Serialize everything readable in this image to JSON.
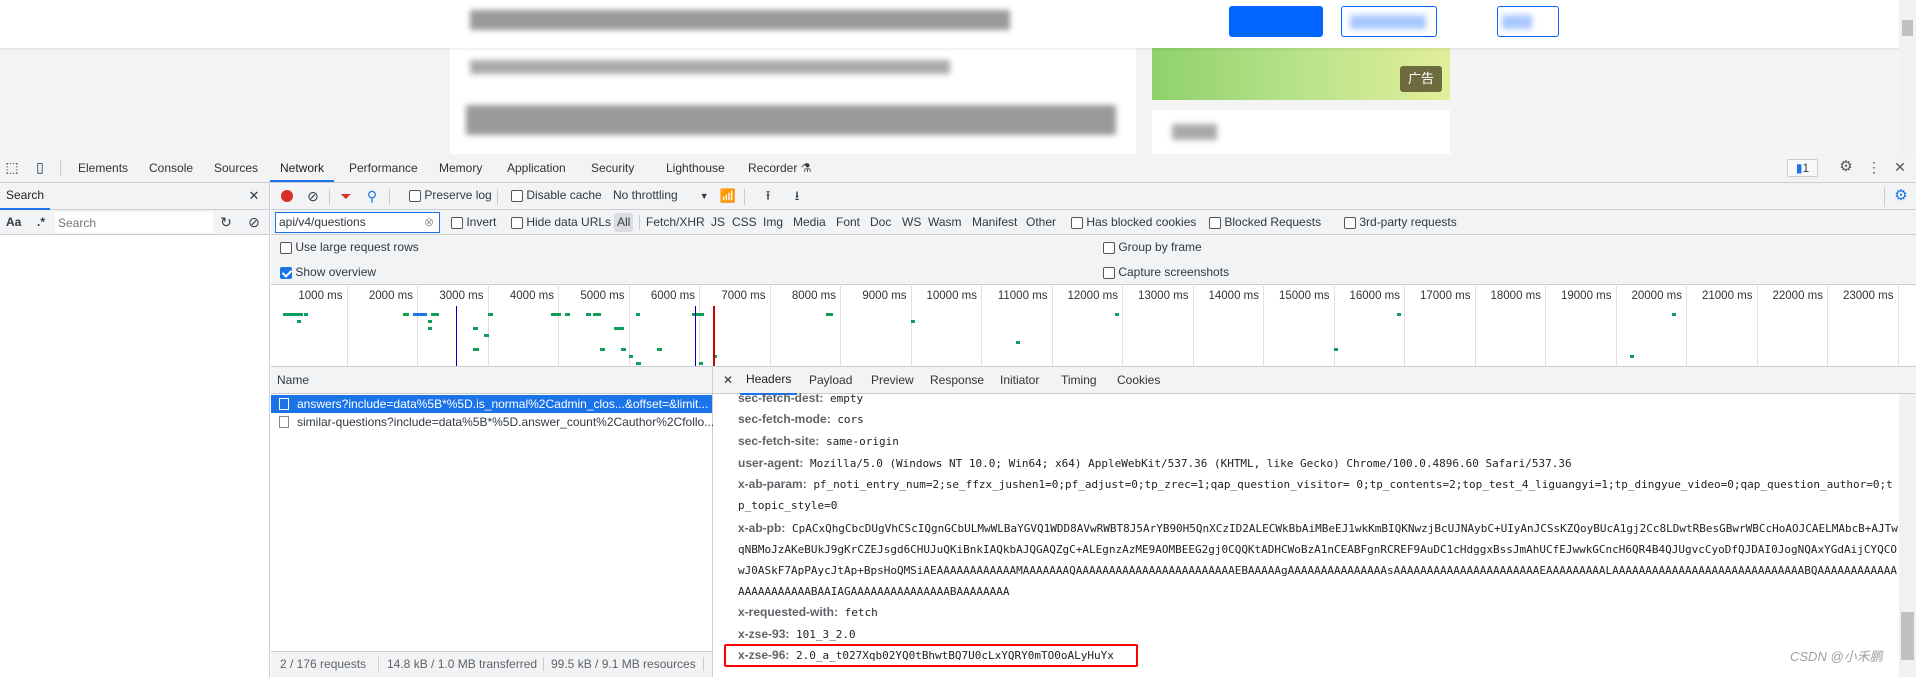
{
  "page": {
    "ad_label": "广告"
  },
  "devtools": {
    "tabs": [
      "Elements",
      "Console",
      "Sources",
      "Network",
      "Performance",
      "Memory",
      "Application",
      "Security",
      "Lighthouse",
      "Recorder"
    ],
    "active_tab": "Network",
    "issues_count": "1",
    "search_panel": {
      "title": "Search",
      "case_label": "Aa",
      "regex_label": ".*",
      "search_placeholder": "Search"
    },
    "toolbar": {
      "preserve_log": "Preserve log",
      "disable_cache": "Disable cache",
      "throttling": "No throttling"
    },
    "filter": {
      "value": "api/v4/questions",
      "invert": "Invert",
      "hide_data_urls": "Hide data URLs",
      "types": [
        "All",
        "Fetch/XHR",
        "JS",
        "CSS",
        "Img",
        "Media",
        "Font",
        "Doc",
        "WS",
        "Wasm",
        "Manifest",
        "Other"
      ],
      "active_type": "All",
      "has_blocked_cookies": "Has blocked cookies",
      "blocked_requests": "Blocked Requests",
      "third_party": "3rd-party requests"
    },
    "options": {
      "large_rows": "Use large request rows",
      "show_overview": "Show overview",
      "show_overview_checked": true,
      "group_by_frame": "Group by frame",
      "capture_screenshots": "Capture screenshots"
    },
    "timeline_ticks": [
      "1000 ms",
      "2000 ms",
      "3000 ms",
      "4000 ms",
      "5000 ms",
      "6000 ms",
      "7000 ms",
      "8000 ms",
      "9000 ms",
      "10000 ms",
      "11000 ms",
      "12000 ms",
      "13000 ms",
      "14000 ms",
      "15000 ms",
      "16000 ms",
      "17000 ms",
      "18000 ms",
      "19000 ms",
      "20000 ms",
      "21000 ms",
      "22000 ms",
      "23000 ms"
    ],
    "requests": {
      "column_name": "Name",
      "rows": [
        {
          "name": "answers?include=data%5B*%5D.is_normal%2Cadmin_clos...&offset=&limit...",
          "selected": true
        },
        {
          "name": "similar-questions?include=data%5B*%5D.answer_count%2Cauthor%2Cfollo...",
          "selected": false
        }
      ]
    },
    "status": {
      "requests": "2 / 176 requests",
      "transferred": "14.8 kB / 1.0 MB transferred",
      "resources": "99.5 kB / 9.1 MB resources"
    },
    "detail_tabs": [
      "Headers",
      "Payload",
      "Preview",
      "Response",
      "Initiator",
      "Timing",
      "Cookies"
    ],
    "active_detail_tab": "Headers",
    "headers": [
      {
        "name": "sec-fetch-dest:",
        "value": "empty"
      },
      {
        "name": "sec-fetch-mode:",
        "value": "cors"
      },
      {
        "name": "sec-fetch-site:",
        "value": "same-origin"
      },
      {
        "name": "user-agent:",
        "value": "Mozilla/5.0 (Windows NT 10.0; Win64; x64) AppleWebKit/537.36 (KHTML, like Gecko) Chrome/100.0.4896.60 Safari/537.36"
      },
      {
        "name": "x-ab-param:",
        "value": "pf_noti_entry_num=2;se_ffzx_jushen1=0;pf_adjust=0;tp_zrec=1;qap_question_visitor= 0;tp_contents=2;top_test_4_liguangyi=1;tp_dingyue_video=0;qap_question_author=0;tp_topic_style=0"
      },
      {
        "name": "x-ab-pb:",
        "value": "CpACxQhgCbcDUgVhCScIQgnGCbULMwWLBaYGVQ1WDD8AVwRWBT8J5ArYB90H5QnXCzID2ALECWkBbAiMBeEJ1wkKmBIQKNwzjBcUJNAybC+UIyAnJCSsKZQoyBUcA1gj2Cc8LDwtRBesGBwrWBCcHoAOJCAELMAbcB+AJTwqNBMoJzAKeBUkJ9gKrCZEJsgd6CHUJuQKiBnkIAQkbAJQGAQZgC+ALEgnzAzME9AOMBEEG2gj0CQQKtADHCWoBzA1nCEABFgnRCREF9AuDC1cHdggxBssJmAhUCfEJwwkGCncH6QR4B4QJUgvcCyoDfQJDAI0JogNQAxYGdAijCYQCOwJ0ASkF7ApPAycJtAp+BpsHoQMSiAEAAAAAAAAAAAAMAAAAAAAQAAAAAAAAAAAAAAAAAAAAAAAAEBAAAAAgAAAAAAAAAAAAAAAsAAAAAAAAAAAAAAAAAAAAAAEAAAAAAAAALAAAAAAAAAAAAAAAAAAAAAAAAAAAAABQAAAAAAAAAAAAAAAAAAAAAAABAAIAGAAAAAAAAAAAAAAABAAAAAAAA"
      },
      {
        "name": "x-requested-with:",
        "value": "fetch"
      },
      {
        "name": "x-zse-93:",
        "value": "101_3_2.0"
      },
      {
        "name": "x-zse-96:",
        "value": "2.0_a_t027Xqb02YQ0tBhwtBQ7U0cLxYQRY0mTO0oALyHuYx",
        "highlighted": true
      }
    ],
    "highlight_color": "#ff0000",
    "accent_color": "#1a73e8"
  },
  "watermark": "CSDN @小禾鹏"
}
